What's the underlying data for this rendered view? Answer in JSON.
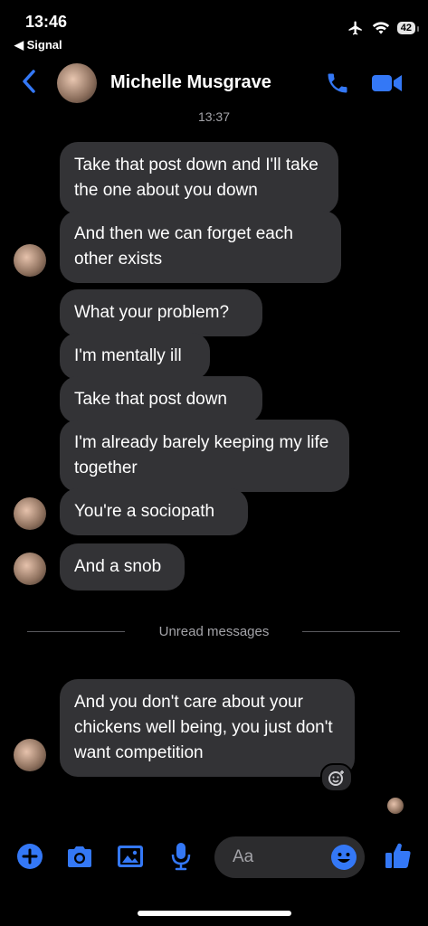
{
  "status": {
    "time": "13:46",
    "back_app": "◀ Signal",
    "battery": "42"
  },
  "header": {
    "contact_name": "Michelle Musgrave",
    "timestamp": "13:37"
  },
  "messages": [
    "Take that post down and I'll take the one about you down",
    "And then we can forget each other exists",
    "What your problem?",
    "I'm mentally ill",
    "Take that post down",
    "I'm already barely keeping my life together",
    "You're a sociopath",
    "And a snob",
    "And you don't care about your chickens well being, you just don't want competition"
  ],
  "divider": {
    "label": "Unread messages"
  },
  "composer": {
    "placeholder": "Aa"
  },
  "colors": {
    "accent": "#3478f6",
    "bubble": "#333336",
    "background": "#000000"
  }
}
